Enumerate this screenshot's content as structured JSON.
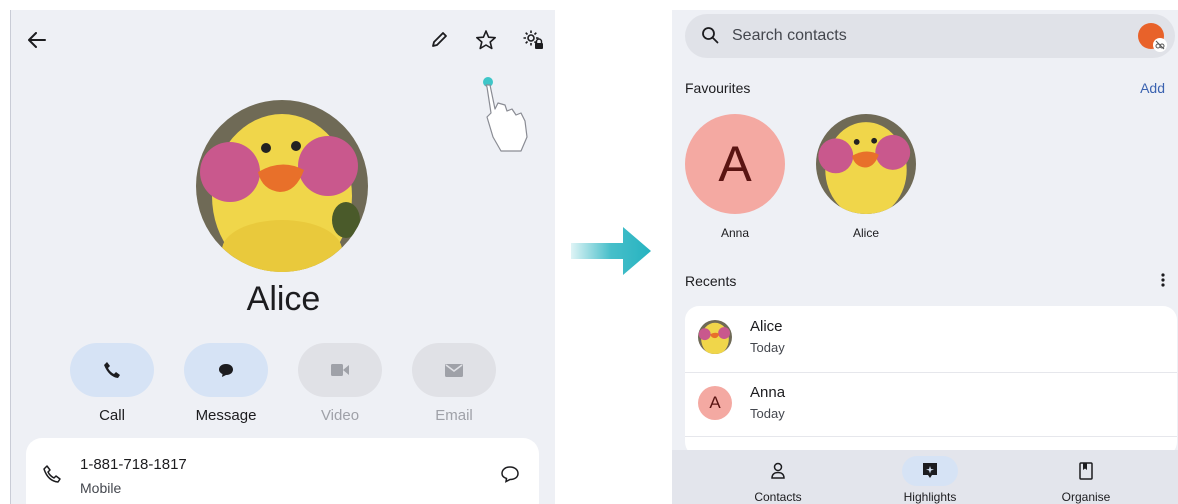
{
  "left": {
    "contact_name": "Alice",
    "actions": [
      {
        "label": "Call",
        "state": "active"
      },
      {
        "label": "Message",
        "state": "active"
      },
      {
        "label": "Video",
        "state": "disabled"
      },
      {
        "label": "Email",
        "state": "disabled"
      }
    ],
    "phone": {
      "number": "1-881-718-1817",
      "type": "Mobile"
    }
  },
  "right": {
    "search_placeholder": "Search contacts",
    "favourites_title": "Favourites",
    "add_label": "Add",
    "favourites": [
      {
        "name": "Anna",
        "initial": "A"
      },
      {
        "name": "Alice"
      }
    ],
    "recents_title": "Recents",
    "recents": [
      {
        "name": "Alice",
        "time": "Today"
      },
      {
        "name": "Anna",
        "time": "Today",
        "initial": "A"
      }
    ],
    "nav": [
      {
        "label": "Contacts"
      },
      {
        "label": "Highlights"
      },
      {
        "label": "Organise"
      }
    ]
  },
  "colors": {
    "screen_bg": "#eef0f5",
    "accent_pill": "#d6e3f5",
    "arrow": "#26b3c0",
    "anna_avatar": "#f4a9a2",
    "profile": "#e8622a"
  }
}
